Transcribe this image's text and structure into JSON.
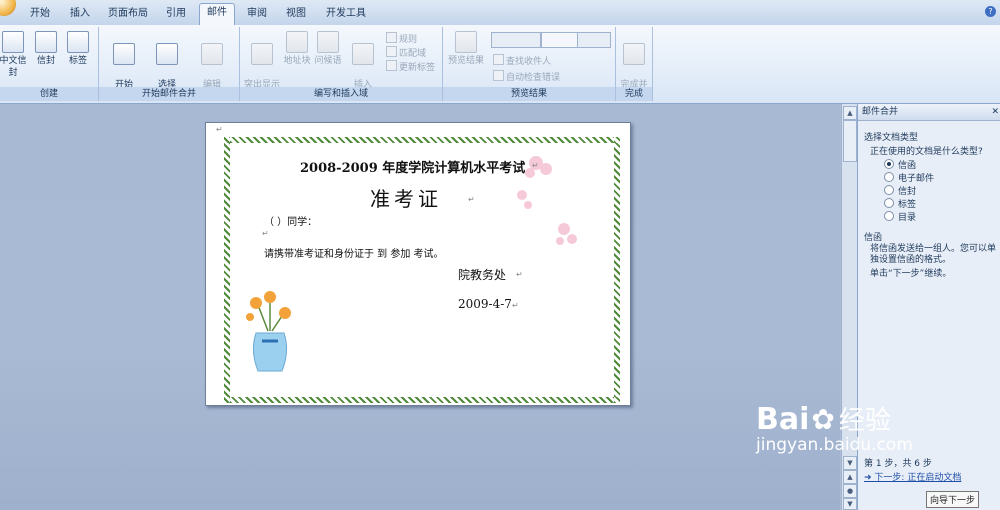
{
  "tabs": [
    "开始",
    "插入",
    "页面布局",
    "引用",
    "邮件",
    "审阅",
    "视图",
    "开发工具"
  ],
  "active_tab": "邮件",
  "ribbon": {
    "groups": [
      {
        "label": "创建",
        "buttons": [
          "中文信封",
          "信封",
          "标签"
        ]
      },
      {
        "label": "开始邮件合并",
        "buttons": [
          "开始\n邮件合并",
          "选择\n收件人",
          "编辑\n收件人列表"
        ]
      },
      {
        "label": "编写和插入域",
        "buttons": [
          "突出显示\n合并域",
          "地址块",
          "问候语",
          "插入\n合并域"
        ],
        "small": [
          "规则",
          "匹配域",
          "更新标签"
        ]
      },
      {
        "label": "预览结果",
        "buttons": [
          "预览结果"
        ],
        "small": [
          "查找收件人",
          "自动检查错误"
        ]
      },
      {
        "label": "完成",
        "buttons": [
          "完成并\n合并"
        ]
      }
    ]
  },
  "document": {
    "title": "2008-2009 年度学院计算机水平考试",
    "heading": "准考证",
    "line1": "（  ）同学：",
    "line2": "请携带准考证和身份证于  到  参加  考试。",
    "signature": "院教务处",
    "date": "2009-4-7"
  },
  "taskpane": {
    "title": "邮件合并",
    "section1": "选择文档类型",
    "question": "正在使用的文档是什么类型?",
    "options": [
      "信函",
      "电子邮件",
      "信封",
      "标签",
      "目录"
    ],
    "selected": "信函",
    "section2": "信函",
    "desc": "将信函发送给一组人。您可以单独设置信函的格式。",
    "instruction": "单击“下一步”继续。",
    "step": "第 1 步，共 6 步",
    "next_link": "下一步: 正在启动文档"
  },
  "tooltip": "向导下一步",
  "watermark": {
    "brand": "Bai",
    "brand_cn": "经验",
    "url": "jingyan.baidu.com"
  }
}
